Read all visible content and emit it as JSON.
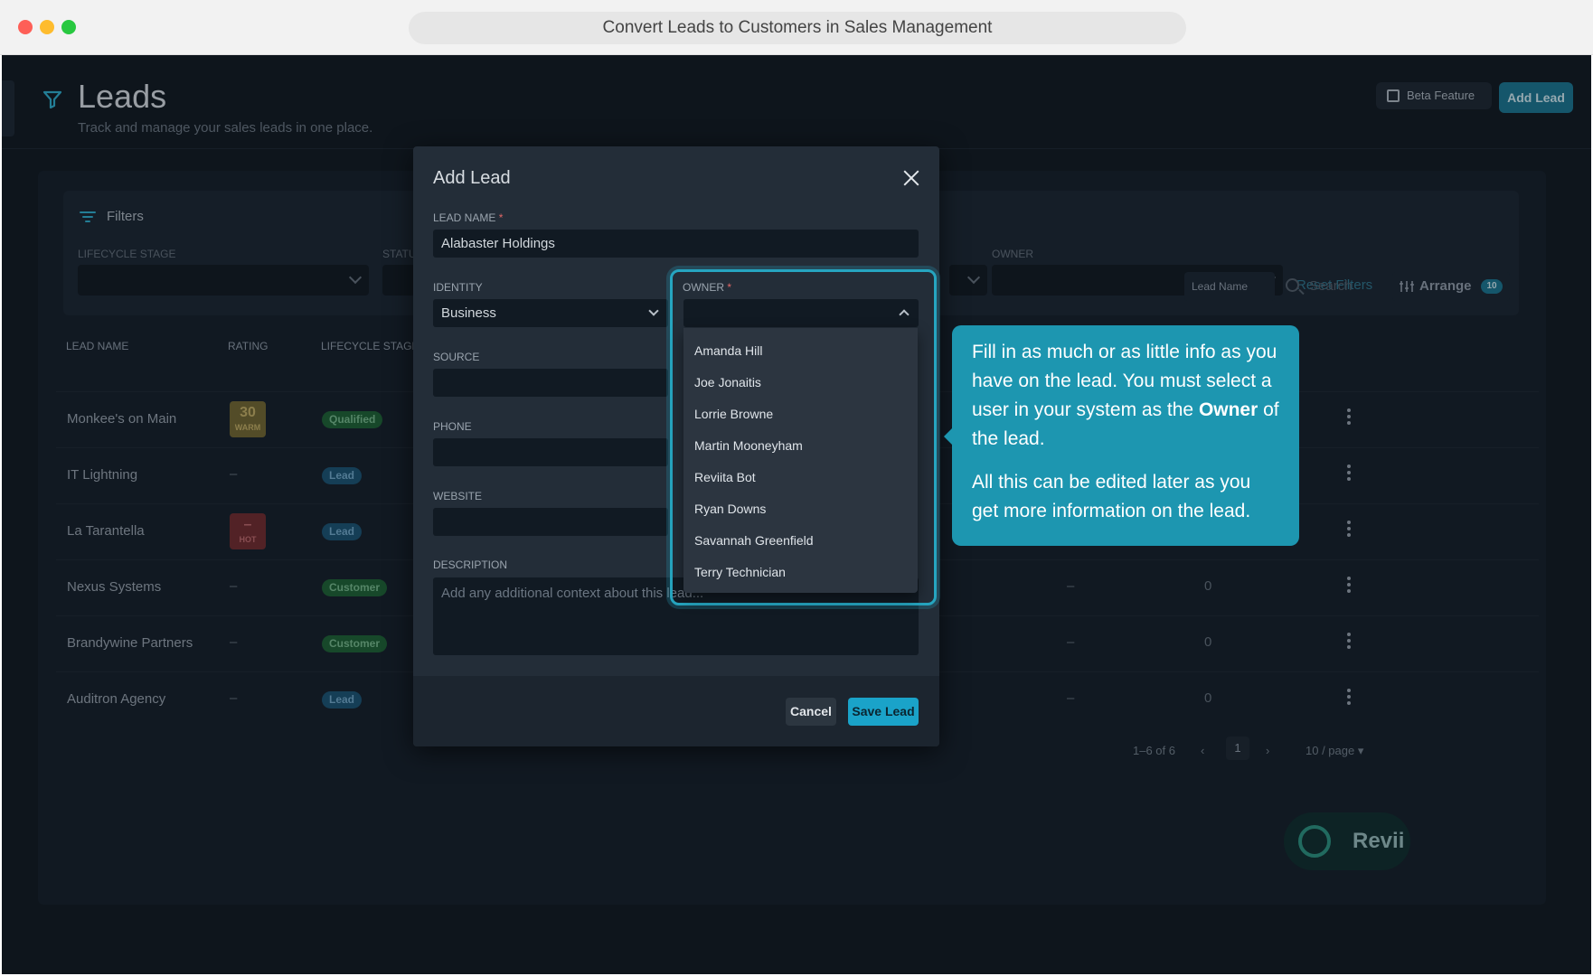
{
  "window": {
    "title": "Convert Leads to Customers in Sales Management"
  },
  "header": {
    "title": "Leads",
    "subtitle": "Track and manage your sales leads in one place.",
    "beta_label": "Beta Feature",
    "add_lead_label": "Add Lead"
  },
  "filters": {
    "label": "Filters",
    "lifecycle_label": "LIFECYCLE STAGE",
    "status_label": "STATUS",
    "owner_label": "OWNER",
    "reset_label": "Reset Filters"
  },
  "toolbar": {
    "sort_field": "Lead Name",
    "search_placeholder": "Search",
    "arrange_label": "Arrange",
    "arrange_count": "10"
  },
  "table": {
    "columns": [
      "LEAD NAME",
      "RATING",
      "LIFECYCLE STAGE"
    ],
    "rows": [
      {
        "name": "Monkee's on Main",
        "rating": "30",
        "rating_label": "WARM",
        "stage": "Qualified"
      },
      {
        "name": "IT Lightning",
        "rating": "–",
        "stage": "Lead"
      },
      {
        "name": "La Tarantella",
        "rating": "–",
        "rating_label": "HOT",
        "stage": "Lead"
      },
      {
        "name": "Nexus Systems",
        "rating": "–",
        "stage": "Customer",
        "col_a": "–",
        "col_b": "0"
      },
      {
        "name": "Brandywine Partners",
        "rating": "–",
        "stage": "Customer",
        "col_a": "–",
        "col_b": "0"
      },
      {
        "name": "Auditron Agency",
        "rating": "–",
        "stage": "Lead",
        "col_a": "–",
        "col_b": "0"
      }
    ]
  },
  "pagination": {
    "range": "1–6 of 6",
    "page": "1",
    "per_page": "10 / page"
  },
  "revii": {
    "label": "Revii"
  },
  "modal": {
    "title": "Add Lead",
    "lead_name_label": "LEAD NAME",
    "lead_name_value": "Alabaster Holdings",
    "identity_label": "IDENTITY",
    "identity_value": "Business",
    "owner_label": "OWNER",
    "source_label": "SOURCE",
    "phone_label": "PHONE",
    "website_label": "WEBSITE",
    "description_label": "DESCRIPTION",
    "description_placeholder": "Add any additional context about this lead...",
    "cancel_label": "Cancel",
    "save_label": "Save Lead",
    "owner_options": [
      "Amanda Hill",
      "Joe Jonaitis",
      "Lorrie Browne",
      "Martin Mooneyham",
      "Reviita Bot",
      "Ryan Downs",
      "Savannah Greenfield",
      "Terry Technician"
    ]
  },
  "tooltip": {
    "line1_pre": "Fill in as much or as little info as you have on the lead. You must select a user in your system as the ",
    "line1_bold": "Owner",
    "line1_post": " of the lead.",
    "line2": "All this can be edited later as you get more information on the lead."
  },
  "colors": {
    "accent": "#1aa3c9",
    "tooltip": "#1d96b0",
    "background": "#101820"
  }
}
